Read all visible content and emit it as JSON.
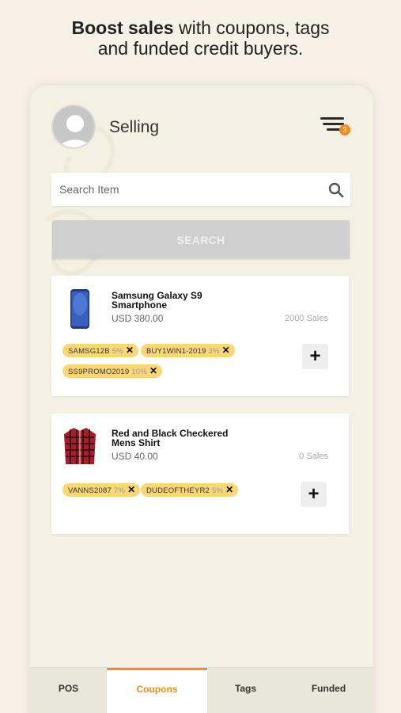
{
  "headline": {
    "bold": "Boost sales",
    "rest": "with coupons, tags",
    "line2": "and funded credit buyers."
  },
  "header": {
    "title": "Selling",
    "menu_badge": "3"
  },
  "search": {
    "placeholder": "Search Item",
    "button_label": "SEARCH"
  },
  "products": [
    {
      "name_line1": "Samsung Galaxy S9",
      "name_line2": "Smartphone",
      "price": "USD 380.00",
      "sales": "2000 Sales",
      "image": "smartphone-image",
      "tags": [
        {
          "code": "SAMSG12B",
          "pct": "5%"
        },
        {
          "code": "BUY1WIN1-2019",
          "pct": "3%"
        },
        {
          "code": "SS9PROMO2019",
          "pct": "10%"
        }
      ]
    },
    {
      "name_line1": "Red and Black Checkered",
      "name_line2": "Mens Shirt",
      "price": "USD 40.00",
      "sales": "0 Sales",
      "image": "shirt-image",
      "tags": [
        {
          "code": "VANNS2087",
          "pct": "7%"
        },
        {
          "code": "DUDEOFTHEYR2",
          "pct": "5%"
        }
      ]
    }
  ],
  "tag_remove_symbol": "✕",
  "add_symbol": "+",
  "nav": {
    "tabs": [
      {
        "label": "POS"
      },
      {
        "label": "Coupons"
      },
      {
        "label": "Tags"
      },
      {
        "label": "Funded"
      }
    ],
    "active": "Coupons"
  },
  "colors": {
    "accent": "#f28c1e",
    "tag": "#f9d778",
    "page_bg": "#f8f1e8",
    "app_bg": "#f4f1e4"
  }
}
